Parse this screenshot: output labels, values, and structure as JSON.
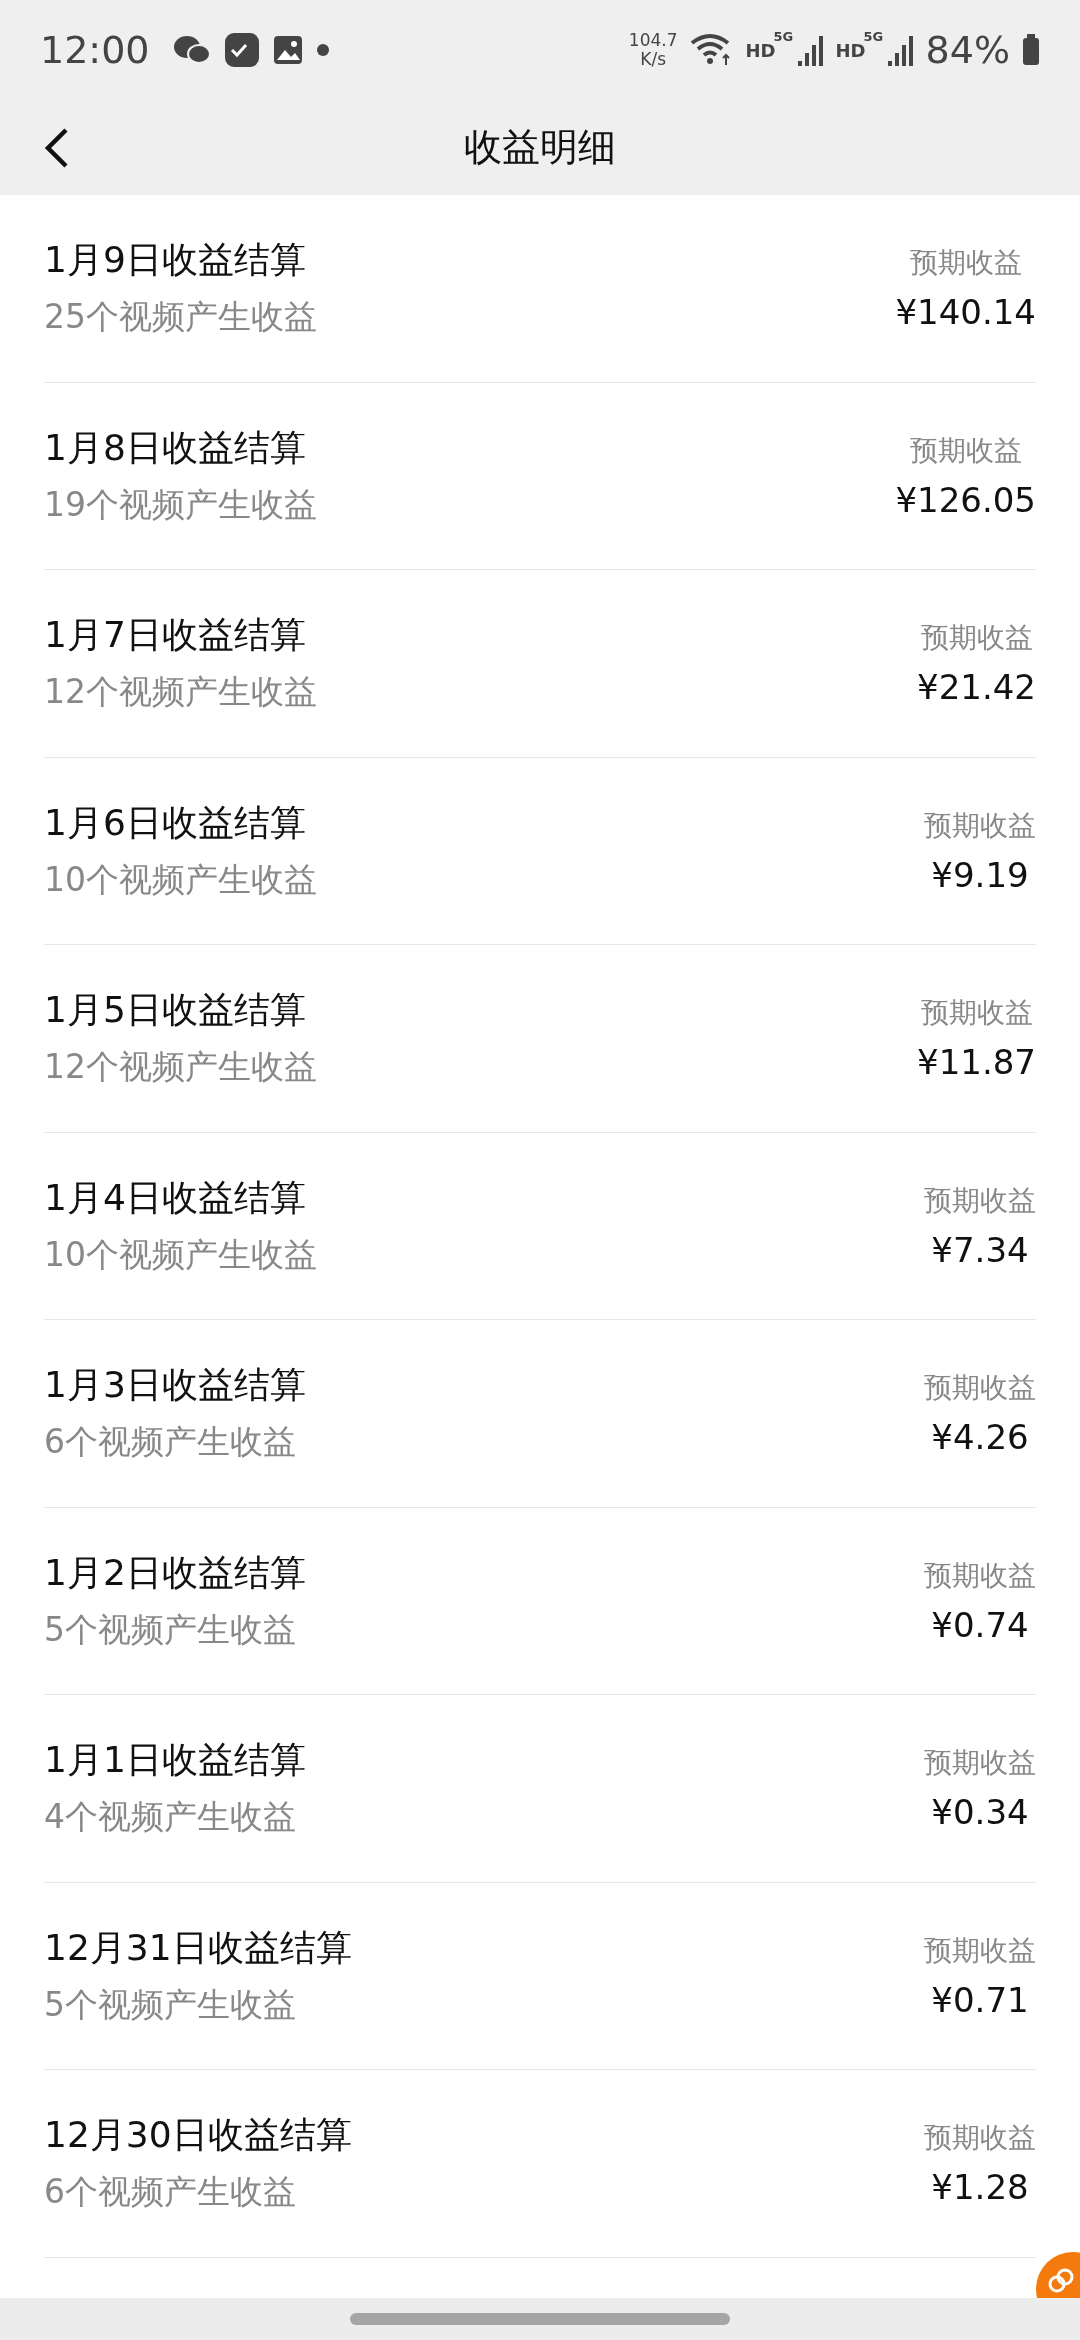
{
  "status_bar": {
    "time": "12:00",
    "speed": "104.7",
    "speed_unit": "K/s",
    "network_1": "HD",
    "network_2": "HD",
    "signal_1": "5G",
    "signal_2": "5G",
    "battery": "84%"
  },
  "header": {
    "title": "收益明细"
  },
  "rows": [
    {
      "title": "1月9日收益结算",
      "subtitle": "25个视频产生收益",
      "label": "预期收益",
      "amount": "¥140.14"
    },
    {
      "title": "1月8日收益结算",
      "subtitle": "19个视频产生收益",
      "label": "预期收益",
      "amount": "¥126.05"
    },
    {
      "title": "1月7日收益结算",
      "subtitle": "12个视频产生收益",
      "label": "预期收益",
      "amount": "¥21.42"
    },
    {
      "title": "1月6日收益结算",
      "subtitle": "10个视频产生收益",
      "label": "预期收益",
      "amount": "¥9.19"
    },
    {
      "title": "1月5日收益结算",
      "subtitle": "12个视频产生收益",
      "label": "预期收益",
      "amount": "¥11.87"
    },
    {
      "title": "1月4日收益结算",
      "subtitle": "10个视频产生收益",
      "label": "预期收益",
      "amount": "¥7.34"
    },
    {
      "title": "1月3日收益结算",
      "subtitle": "6个视频产生收益",
      "label": "预期收益",
      "amount": "¥4.26"
    },
    {
      "title": "1月2日收益结算",
      "subtitle": "5个视频产生收益",
      "label": "预期收益",
      "amount": "¥0.74"
    },
    {
      "title": "1月1日收益结算",
      "subtitle": "4个视频产生收益",
      "label": "预期收益",
      "amount": "¥0.34"
    },
    {
      "title": "12月31日收益结算",
      "subtitle": "5个视频产生收益",
      "label": "预期收益",
      "amount": "¥0.71"
    },
    {
      "title": "12月30日收益结算",
      "subtitle": "6个视频产生收益",
      "label": "预期收益",
      "amount": "¥1.28"
    }
  ]
}
